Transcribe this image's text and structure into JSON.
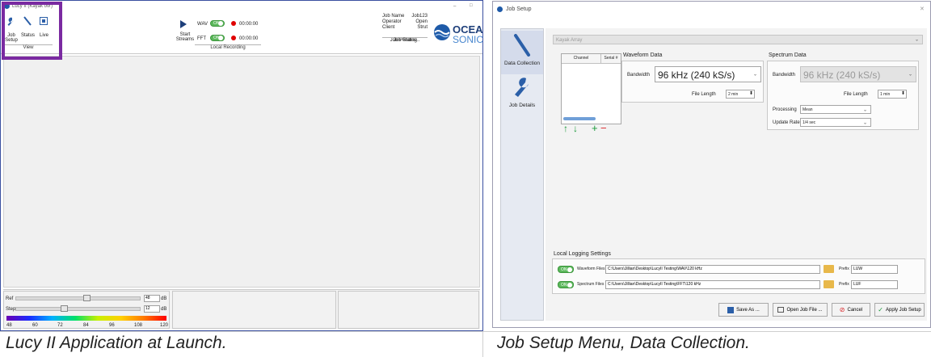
{
  "left_app": {
    "title": "Lucy II (Kayak ovr)",
    "view_group": {
      "buttons": [
        "Job\nSetup",
        "Status",
        "Live"
      ],
      "label": "View"
    },
    "stream": {
      "label": "Start\nStreams"
    },
    "recording": {
      "wav_label": "WAV",
      "fft_label": "FFT",
      "wav_toggle": "ON",
      "fft_toggle": "ON",
      "wav_time": "00:00:00",
      "fft_time": "00:00:00",
      "group_label": "Local Recording"
    },
    "job_status": {
      "rows": [
        {
          "key": "Job Name",
          "value": "Job123"
        },
        {
          "key": "Operator",
          "value": "Open"
        },
        {
          "key": "Client",
          "value": "Strut"
        }
      ],
      "pending": "Job Pending..",
      "group_label": "Job Status"
    },
    "logo": {
      "top": "OCEA",
      "bottom": "SONIC"
    },
    "controls": {
      "ref_label": "Ref",
      "ref_value": "48",
      "step_label": "Step",
      "step_value": "12",
      "unit": "dB",
      "scale_ticks": [
        "48",
        "60",
        "72",
        "84",
        "96",
        "108",
        "120"
      ],
      "ref_fraction": 0.57,
      "step_fraction": 0.38
    }
  },
  "setup_window": {
    "title": "Job Setup",
    "sidebar": {
      "items": [
        {
          "label": "Data Collection",
          "icon": "hydrophone-icon"
        },
        {
          "label": "Job Details",
          "icon": "wrench-icon"
        }
      ]
    },
    "device_combo": "Kayak Array",
    "channel_table": {
      "columns": [
        "Channel",
        "Serial #"
      ]
    },
    "waveform": {
      "title": "Waveform Data",
      "bandwidth_label": "Bandwidth",
      "bandwidth_value": "96 kHz (240 kS/s)",
      "file_length_label": "File Length",
      "file_length_value": "2 min"
    },
    "spectrum": {
      "title": "Spectrum Data",
      "bandwidth_label": "Bandwidth",
      "bandwidth_value": "96 kHz (240 kS/s)",
      "file_length_label": "File Length",
      "file_length_value": "1 min",
      "processing_label": "Processing",
      "processing_value": "Mean",
      "update_label": "Update Rate",
      "update_value": "1/4 sec"
    },
    "logging": {
      "title": "Local Logging Settings",
      "rows": [
        {
          "toggle": "ON",
          "label": "Waveform Files",
          "path": "C:\\Users\\Jillian\\Desktop\\LucyII Testing\\WAV\\120 kHz",
          "prefix_label": "Prefix",
          "prefix": "LUW"
        },
        {
          "toggle": "ON",
          "label": "Spectrum Files",
          "path": "C:\\Users\\Jillian\\Desktop\\LucyII Testing\\FFT\\120 kHz",
          "prefix_label": "Prefix",
          "prefix": "LUF"
        }
      ]
    },
    "buttons": {
      "save_as": "Save As ...",
      "open_job": "Open Job File ...",
      "cancel": "Cancel",
      "apply": "Apply Job Setup"
    }
  },
  "captions": {
    "left": "Lucy II Application at Launch.",
    "right": "Job Setup Menu, Data Collection."
  },
  "colors": {
    "highlight": "#7a2aa1",
    "toggle_on": "#5cb85c",
    "record": "#e00000",
    "logo_blue": "#1e5aa8"
  }
}
